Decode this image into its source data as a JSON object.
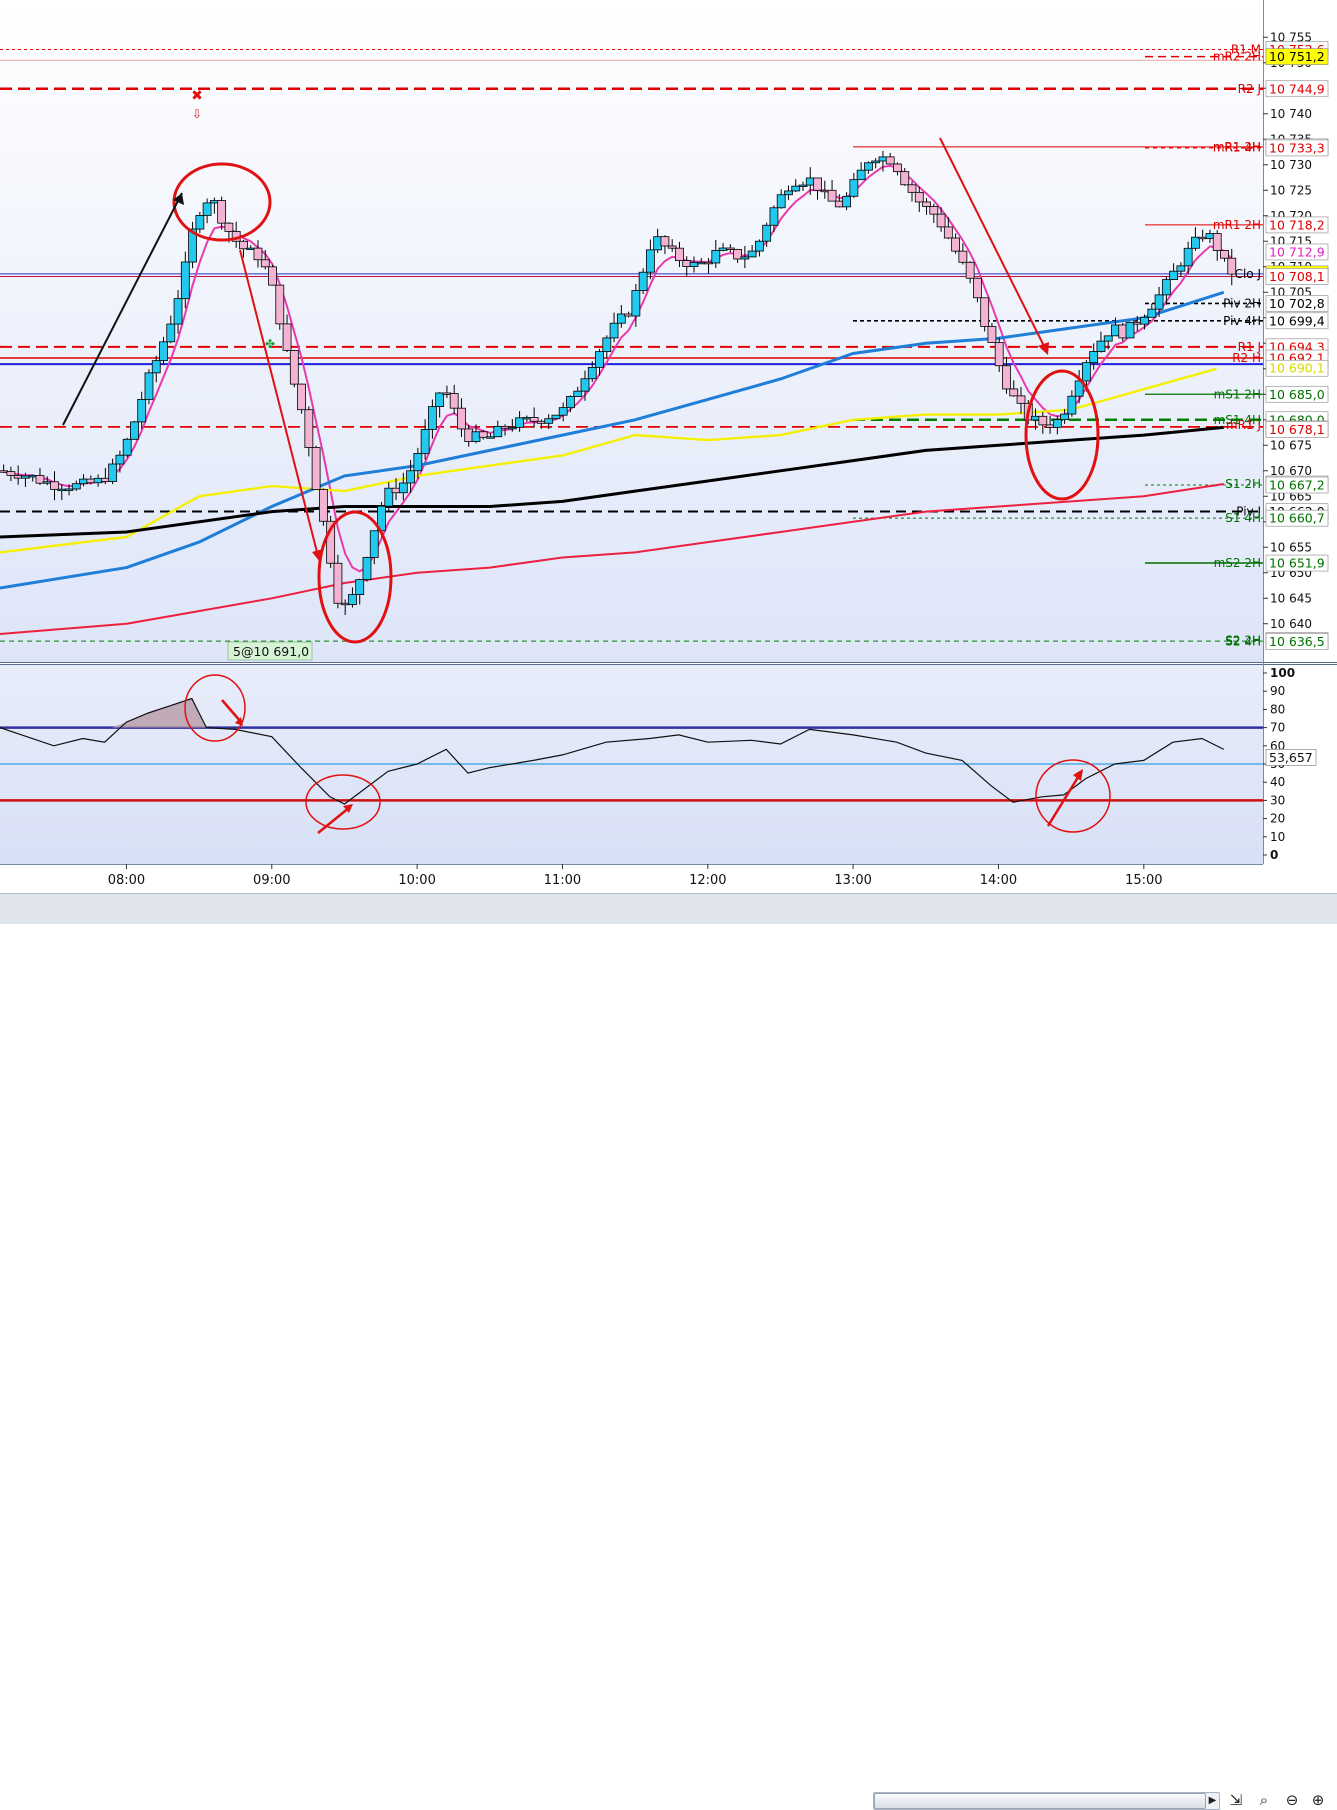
{
  "chart_data": {
    "type": "candlestick",
    "price_axis": {
      "ylim": [
        10632.5,
        10756.5
      ],
      "ticks": [
        "10 640",
        "10 645",
        "10 650",
        "10 655",
        "10 660",
        "10 665",
        "10 670",
        "10 675",
        "10 680",
        "10 685",
        "10 690",
        "10 695",
        "10 700",
        "10 705",
        "10 710",
        "10 715",
        "10 720",
        "10 725",
        "10 730",
        "10 735",
        "10 740",
        "10 745",
        "10 750",
        "10 755"
      ]
    },
    "time_axis": {
      "labels": [
        "08:00",
        "09:00",
        "10:00",
        "11:00",
        "12:00",
        "13:00",
        "14:00",
        "15:00"
      ],
      "hours_span": [
        7.13,
        15.82
      ]
    },
    "level_tags": [
      {
        "value": "10 752,6",
        "bg": "#ffffff",
        "fg": "#e00000"
      },
      {
        "value": "10 751,2",
        "bg": "#ffff00",
        "fg": "#000000"
      },
      {
        "value": "10 744,9",
        "bg": "#ffffff",
        "fg": "#e00000"
      },
      {
        "value": "10 733,5",
        "bg": "#ffffff",
        "fg": "#e00000"
      },
      {
        "value": "10 733,3",
        "bg": "#ffffff",
        "fg": "#e00000"
      },
      {
        "value": "10 718,2",
        "bg": "#ffffff",
        "fg": "#e00000"
      },
      {
        "value": "10 712,9",
        "bg": "#ffffff",
        "fg": "#e020c0"
      },
      {
        "value": "10 708,6",
        "bg": "#ffff00",
        "fg": "#000000"
      },
      {
        "value": "10 708,1",
        "bg": "#ffffff",
        "fg": "#e00000"
      },
      {
        "value": "10 702,8",
        "bg": "#ffffff",
        "fg": "#000000"
      },
      {
        "value": "10 699,4",
        "bg": "#ffffff",
        "fg": "#000000"
      },
      {
        "value": "10 694,3",
        "bg": "#ffffff",
        "fg": "#e00000"
      },
      {
        "value": "10 692,1",
        "bg": "#ffffff",
        "fg": "#e00000"
      },
      {
        "value": "10 690,1",
        "bg": "#ffffff",
        "fg": "#d8d800"
      },
      {
        "value": "10 685,0",
        "bg": "#ffffff",
        "fg": "#007000"
      },
      {
        "value": "10 680,0",
        "bg": "#ffffff",
        "fg": "#007000"
      },
      {
        "value": "10 678,2",
        "bg": "#ffffff",
        "fg": "#e00000"
      },
      {
        "value": "10 678,1",
        "bg": "#ffffff",
        "fg": "#e00000"
      },
      {
        "value": "10 667,4",
        "bg": "#ffffff",
        "fg": "#e00000"
      },
      {
        "value": "10 667,2",
        "bg": "#ffffff",
        "fg": "#007000"
      },
      {
        "value": "10 662,0",
        "bg": "#ffffff",
        "fg": "#000000"
      },
      {
        "value": "10 660,7",
        "bg": "#ffffff",
        "fg": "#007000"
      },
      {
        "value": "10 651,9",
        "bg": "#ffffff",
        "fg": "#007000"
      },
      {
        "value": "10 636,7",
        "bg": "#ffffff",
        "fg": "#007000"
      },
      {
        "value": "10 636,5",
        "bg": "#ffffff",
        "fg": "#007000"
      }
    ],
    "level_labels": [
      {
        "text": "R1 M",
        "price": 10752.6,
        "color": "#e00000"
      },
      {
        "text": "mR2 2H",
        "price": 10751.2,
        "color": "#e00000"
      },
      {
        "text": "R2 J",
        "price": 10744.9,
        "color": "#e00000"
      },
      {
        "text": "mR1 2H",
        "price": 10733.5,
        "color": "#e00000"
      },
      {
        "text": "mR1 4H",
        "price": 10733.4,
        "color": "#e00000"
      },
      {
        "text": "mR1 2H",
        "price": 10718.2,
        "color": "#e00000"
      },
      {
        "text": "Clo J",
        "price": 10708.6,
        "color": "#000000"
      },
      {
        "text": "Piv 2H",
        "price": 10702.8,
        "color": "#000000"
      },
      {
        "text": "Piv 4H",
        "price": 10699.4,
        "color": "#000000"
      },
      {
        "text": "R1 J",
        "price": 10694.3,
        "color": "#e00000"
      },
      {
        "text": "R2 H",
        "price": 10692.1,
        "color": "#e00000"
      },
      {
        "text": "mS1 2H",
        "price": 10685.0,
        "color": "#007000"
      },
      {
        "text": "mS1 4H",
        "price": 10680.0,
        "color": "#007000"
      },
      {
        "text": "mR1 J",
        "price": 10679.0,
        "color": "#e00000"
      },
      {
        "text": "S1 2H",
        "price": 10667.4,
        "color": "#007000"
      },
      {
        "text": "Piv J",
        "price": 10662.0,
        "color": "#000000"
      },
      {
        "text": "S1 4H",
        "price": 10660.7,
        "color": "#007000"
      },
      {
        "text": "mS2 2H",
        "price": 10651.9,
        "color": "#007000"
      },
      {
        "text": "S2 2H",
        "price": 10636.7,
        "color": "#007000"
      },
      {
        "text": "S2 4H",
        "price": 10636.5,
        "color": "#007000"
      }
    ],
    "order_label": "5@10 691,0",
    "oscillator": {
      "ylim": [
        -5,
        105
      ],
      "ticks": [
        "0",
        "10",
        "20",
        "30",
        "40",
        "50",
        "60",
        "70",
        "80",
        "90",
        "100"
      ],
      "current_value": "53,657",
      "levels": [
        70,
        30,
        50
      ]
    },
    "colors": {
      "bull_candle": "#22c8ee",
      "bear_candle": "#f3b3d3",
      "ema_fast": "#e83aae",
      "ema_mid": "#f5f000",
      "ema_slow_blue": "#1e7ed8",
      "ema_red": "#ee2040",
      "ema_black": "#000000",
      "annotation_red": "#e21010"
    }
  }
}
